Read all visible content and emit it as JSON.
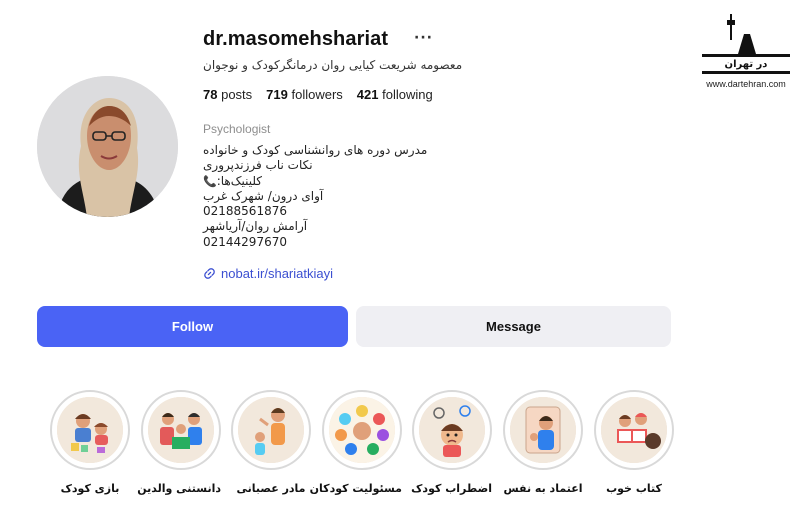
{
  "profile": {
    "username": "dr.masomehshariat",
    "more": "···",
    "full_name": "معصومه شریعت کیایی روان درمانگرکودک و نوجوان",
    "stats": {
      "posts_count": "78",
      "posts_label": "posts",
      "followers_count": "719",
      "followers_label": "followers",
      "following_count": "421",
      "following_label": "following"
    },
    "category": "Psychologist",
    "bio": {
      "line1": "مدرس دوره های روانشناسی کودک و خانواده",
      "line2": "نکات ناب فرزندپروری",
      "line3_emoji": "📞",
      "line3": "کلینیک‌ها:",
      "line4": "آوای درون/ شهرک غرب",
      "line5": "02188561876",
      "line6": "آرامش روان/آریاشهر",
      "line7": "02144297670"
    },
    "link": "nobat.ir/shariatkiayi"
  },
  "buttons": {
    "follow": "Follow",
    "message": "Message"
  },
  "highlights": [
    {
      "label": "بازی کودک",
      "icon": "kids-playing-icon"
    },
    {
      "label": "دانستنی والدین",
      "icon": "family-reading-icon"
    },
    {
      "label": "مادر عصبانی",
      "icon": "angry-mother-icon"
    },
    {
      "label": "مسئولیت کودکان",
      "icon": "children-circle-icon"
    },
    {
      "label": "اضطراب کودک",
      "icon": "anxious-child-icon"
    },
    {
      "label": "اعتماد به نفس",
      "icon": "confident-child-icon"
    },
    {
      "label": "کتاب خوب",
      "icon": "kids-book-icon"
    }
  ],
  "watermark": {
    "logo_text": "در تهران",
    "url": "www.dartehran.com"
  },
  "colors": {
    "follow_bg": "#4a63f5",
    "message_bg": "#efeff3",
    "link": "#3b4fd1"
  }
}
